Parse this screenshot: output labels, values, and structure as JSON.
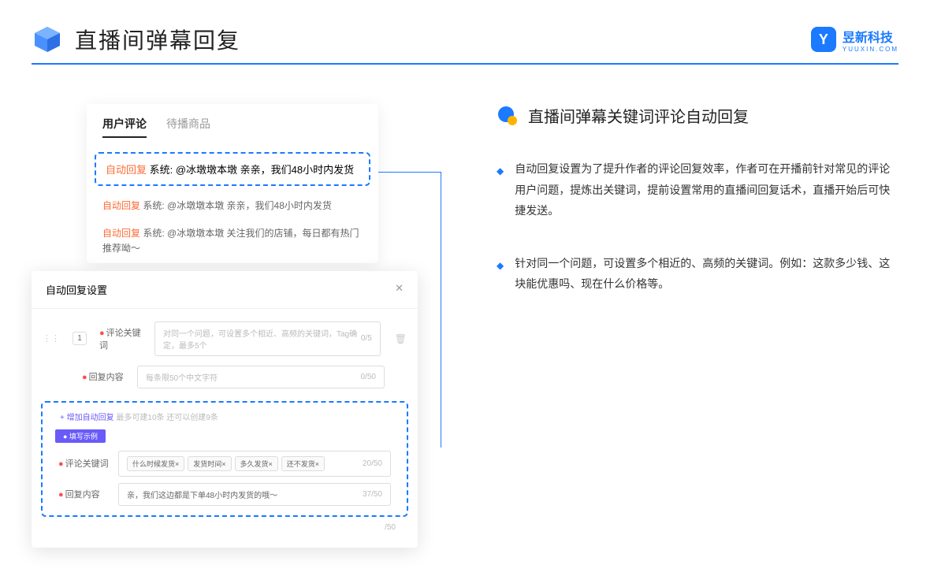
{
  "header": {
    "title": "直播间弹幕回复",
    "brand_name": "昱新科技",
    "brand_sub": "YUUXIN.COM",
    "brand_letter": "Y"
  },
  "card1": {
    "tabs": [
      "用户评论",
      "待播商品"
    ],
    "highlighted": {
      "tag": "自动回复",
      "text": "系统: @冰墩墩本墩 亲亲，我们48小时内发货"
    },
    "replies": [
      {
        "tag": "自动回复",
        "text": "系统: @冰墩墩本墩 亲亲，我们48小时内发货"
      },
      {
        "tag": "自动回复",
        "text": "系统: @冰墩墩本墩 关注我们的店铺，每日都有热门推荐呦～"
      }
    ]
  },
  "card2": {
    "title": "自动回复设置",
    "row_num": "1",
    "field1": {
      "label": "评论关键词",
      "placeholder": "对同一个问题，可设置多个相近、高频的关键词，Tag确定，最多5个",
      "counter": "0/5"
    },
    "field2": {
      "label": "回复内容",
      "placeholder": "每条限50个中文字符",
      "counter": "0/50"
    },
    "add_link": "+ 增加自动回复",
    "add_sub": "最多可建10条 还可以创建9条",
    "example_tag": "● 填写示例",
    "ex1": {
      "label": "评论关键词",
      "tags": [
        "什么时候发货×",
        "发货时间×",
        "多久发货×",
        "还不发货×"
      ],
      "counter": "20/50"
    },
    "ex2": {
      "label": "回复内容",
      "value": "亲，我们这边都是下单48小时内发货的哦～",
      "counter": "37/50"
    },
    "outer_counter": "/50"
  },
  "right": {
    "heading": "直播间弹幕关键词评论自动回复",
    "bullets": [
      "自动回复设置为了提升作者的评论回复效率，作者可在开播前针对常见的评论用户问题，提炼出关键词，提前设置常用的直播间回复话术，直播开始后可快捷发送。",
      "针对同一个问题，可设置多个相近的、高频的关键词。例如：这款多少钱、这块能优惠吗、现在什么价格等。"
    ]
  }
}
